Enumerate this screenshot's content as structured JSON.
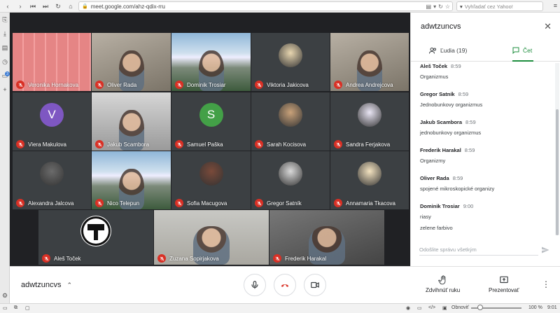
{
  "browser": {
    "url": "meet.google.com/ahz-qdix-rru",
    "search_placeholder": "Vyhľadať cez Yahoo!",
    "sidebar_badge": "3"
  },
  "tiles": [
    {
      "name": "Veronika Hornakova",
      "type": "photo-pattern"
    },
    {
      "name": "Oliver Rada",
      "type": "video-room"
    },
    {
      "name": "Dominik Trosiar",
      "type": "video-mountain"
    },
    {
      "name": "Viktoria Jakicova",
      "type": "avatar-image"
    },
    {
      "name": "Andrea Andrejcova",
      "type": "video-room"
    },
    {
      "name": "Viera Makulova",
      "type": "letter",
      "letter": "V",
      "color": "#7e57c2"
    },
    {
      "name": "Jakub Scambora",
      "type": "video-gray"
    },
    {
      "name": "Samuel Paška",
      "type": "letter",
      "letter": "S",
      "color": "#43a047"
    },
    {
      "name": "Sarah Kocisova",
      "type": "avatar-image"
    },
    {
      "name": "Sandra Ferjakova",
      "type": "avatar-image"
    },
    {
      "name": "Alexandra Jalcova",
      "type": "avatar-image"
    },
    {
      "name": "Nico Telepun",
      "type": "video-mountain"
    },
    {
      "name": "Sofia Macugova",
      "type": "avatar-image"
    },
    {
      "name": "Gregor Satník",
      "type": "avatar-image"
    },
    {
      "name": "Annamaria Tkacova",
      "type": "avatar-image"
    },
    {
      "name": "Aleš Toček",
      "type": "logo"
    },
    {
      "name": "Zuzana Sopirjakova",
      "type": "video-person"
    },
    {
      "name": "Frederik Harakal",
      "type": "video-room"
    }
  ],
  "controls": {
    "meeting_code": "adwtzuncvs",
    "raise_hand": "Zdvihnúť ruku",
    "present": "Prezentovať"
  },
  "panel": {
    "title": "adwtzuncvs",
    "tab_people": "Ľudia (19)",
    "tab_chat": "Čet",
    "messages": [
      {
        "sender": "Aleš Toček",
        "time": "8:59",
        "text": "Organizmus"
      },
      {
        "sender": "Gregor Satník",
        "time": "8:59",
        "text": "Jednobunkovy organizmus"
      },
      {
        "sender": "Jakub Scambora",
        "time": "8:59",
        "text": "jednobunkovy organizmus"
      },
      {
        "sender": "Frederik Harakal",
        "time": "8:59",
        "text": "Organizmy"
      },
      {
        "sender": "Oliver Rada",
        "time": "8:59",
        "text": "spojené mikroskopické organizy"
      },
      {
        "sender": "Dominik Trosiar",
        "time": "9:00",
        "text": "riasy"
      },
      {
        "sender": "",
        "time": "",
        "text": "zelene farbivo"
      }
    ],
    "input_placeholder": "Odošlite správu všetkým"
  },
  "statusbar": {
    "refresh": "Obnoviť",
    "zoom": "100 %",
    "time": "9:01"
  },
  "colors": {
    "muted_red": "#d93025",
    "chat_green": "#1e8e3e",
    "meet_bg": "#202124"
  }
}
